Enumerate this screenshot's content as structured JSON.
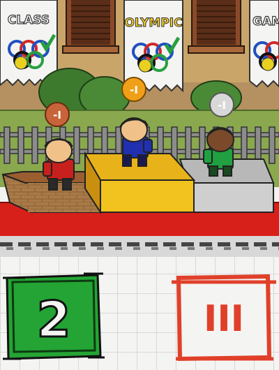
{
  "banners": [
    {
      "text": "CLASS"
    },
    {
      "text": "OLYMPIC"
    },
    {
      "text": "GAME"
    }
  ],
  "medals": [
    {
      "label": "-I",
      "color": "#c8643a"
    },
    {
      "label": "-I",
      "color": "#f0a018"
    },
    {
      "label": "-I",
      "color": "#d8d8d8"
    }
  ],
  "podium": [
    {
      "place": "second",
      "color": "#d08840"
    },
    {
      "place": "first",
      "color": "#f2c21e"
    },
    {
      "place": "third",
      "color": "#cfcfcf"
    }
  ],
  "controls": {
    "left_glyph": "2",
    "left_color": "#24a434",
    "right_glyph": "III",
    "right_color": "#e0402a"
  }
}
